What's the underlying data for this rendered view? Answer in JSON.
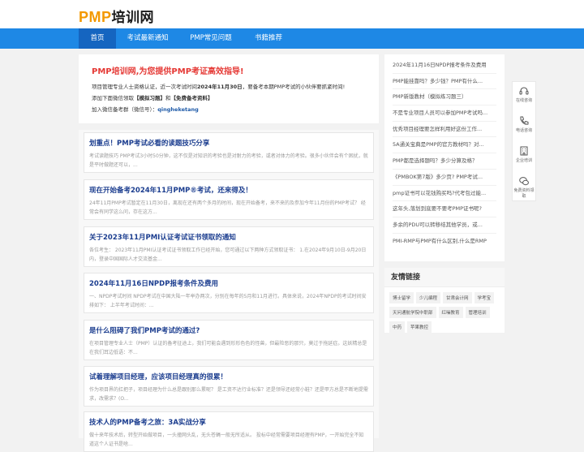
{
  "logo": {
    "latin": "PMP",
    "cn": "培训网"
  },
  "nav": {
    "items": [
      "首页",
      "考试最新通知",
      "PMP常见问题",
      "书籍推荐"
    ]
  },
  "hero": {
    "title": "PMP培训网,为您提供PMP考证高效指导!",
    "line1_pre": "项目管理专业人士资格认证，近一次考试时间",
    "line1_date": "2024年11月30日",
    "line1_post": "，要备考本期PMP考试的小伙伴要抓紧时间!",
    "line2_pre": "添加下面微信领取",
    "line2_b1": "【模拟习题】",
    "line2_mid": "和",
    "line2_b2": "【免费备考资料】",
    "line3_pre": "加入微信备考群（微信号）：",
    "line3_wx": "qingheketang"
  },
  "articles": [
    {
      "title": "划重点！PMP考试必看的读题技巧分享",
      "desc": "考试读题技巧 PMP考试3小时50分钟，这不仅是对知识的考验也是对耐力的考验，或者对体力的考验。很多小伙伴会有个困扰，就是平时做题还可以，..."
    },
    {
      "title": "现在开始备考2024年11月PMP®考试，还来得及！",
      "desc": "24年11月PMP考试暂定在11月30日，离现在还有两个多月的时间，现在开始备考，来不来的及参加今年11月份的PMP考试？ 经常会有同学这么问，存在这方..."
    },
    {
      "title": "关于2023年11月PMI认证考试证书领取的通知",
      "desc": "各位考生： 2023年11月PMI认证考试证书领取工作已经开始，您可通过以下两种方式领取证书： 1.在2024年9月10日-9月20日内，登录中国国际人才交流基金..."
    },
    {
      "title": "2024年11月16日NPDP报考条件及费用",
      "desc": "一、NPDP考试时间 NPDP考试在中国大陆一年举办两次，分别在每年的5月和11月进行。具体来说，2024年NPDP的考试时间安排如下： 上半年考试时间：..."
    },
    {
      "title": "是什么阻碍了我们PMP考试的通过?",
      "desc": "在项目管理专业人士（PMP）认证的备考征途上，我们可能会遇到形形色色的怪兽，但最险恶的那只，莫过于拖延症。这妖精总是在我们耳边低语：不..."
    },
    {
      "title": "试着理解项目经理，应该项目经理真的很累！",
      "desc": "作为项目界的扛把子，项目经理为什么总是跟别那么累呢？ 是工资不达行业标准？还是领导还经常小鞋？还是甲方总是不断地提需求，改需求？(O..."
    },
    {
      "title": "技术人的PMP备考之旅：3A实战分享",
      "desc": "做十来年技术后，转型开始做项目，一头撞网头乱，无头苍蝇一般无所适从。 投标中经常需要项目经理有PMP，一开始完全不知道这个人证书是啥..."
    }
  ],
  "sidebar": {
    "links": [
      "2024年11月16日NPDP报考条件及费用",
      "PMP能挂靠吗？多少钱？PMP有什么...",
      "PMP新版教材（模拟练习题三）",
      "不是专业项目人员可以参加PMP考试吗...",
      "优秀项目经理要怎样利用好这份工作...",
      "5A通关宝典是PMP的官方教材吗？对...",
      "PMP都是选择题吗？多少分算及格？",
      "《PMBOK第7版》多少页? PMP考试...",
      "pmp证书可以花钱购买吗?代考包过能...",
      "这年头,落划到底要不要考PMP证书呢?",
      "多余的PDU可以转移结其他学员，或...",
      "PMI-RMP与PMP有什么区别,什么是RMP"
    ]
  },
  "friends": {
    "title": "友情链接",
    "links": [
      "博士留学",
      "少儿编程",
      "甘肃会计网",
      "学考宝",
      "天问通航学院中职部",
      "红噪教育",
      "管理培训",
      "中药",
      "苹果教控"
    ]
  },
  "float_bar": {
    "items": [
      {
        "label": "在线咨询",
        "icon": "headset-icon"
      },
      {
        "label": "电话咨询",
        "icon": "phone-icon"
      },
      {
        "label": "企业培训",
        "icon": "building-icon"
      },
      {
        "label": "免费资料领取",
        "icon": "wechat-icon"
      }
    ]
  },
  "colors": {
    "nav": "#1e88e5",
    "nav_active": "#1565c0",
    "accent": "#f39800",
    "hero_title": "#e53935",
    "article_title": "#1b3d8f"
  }
}
